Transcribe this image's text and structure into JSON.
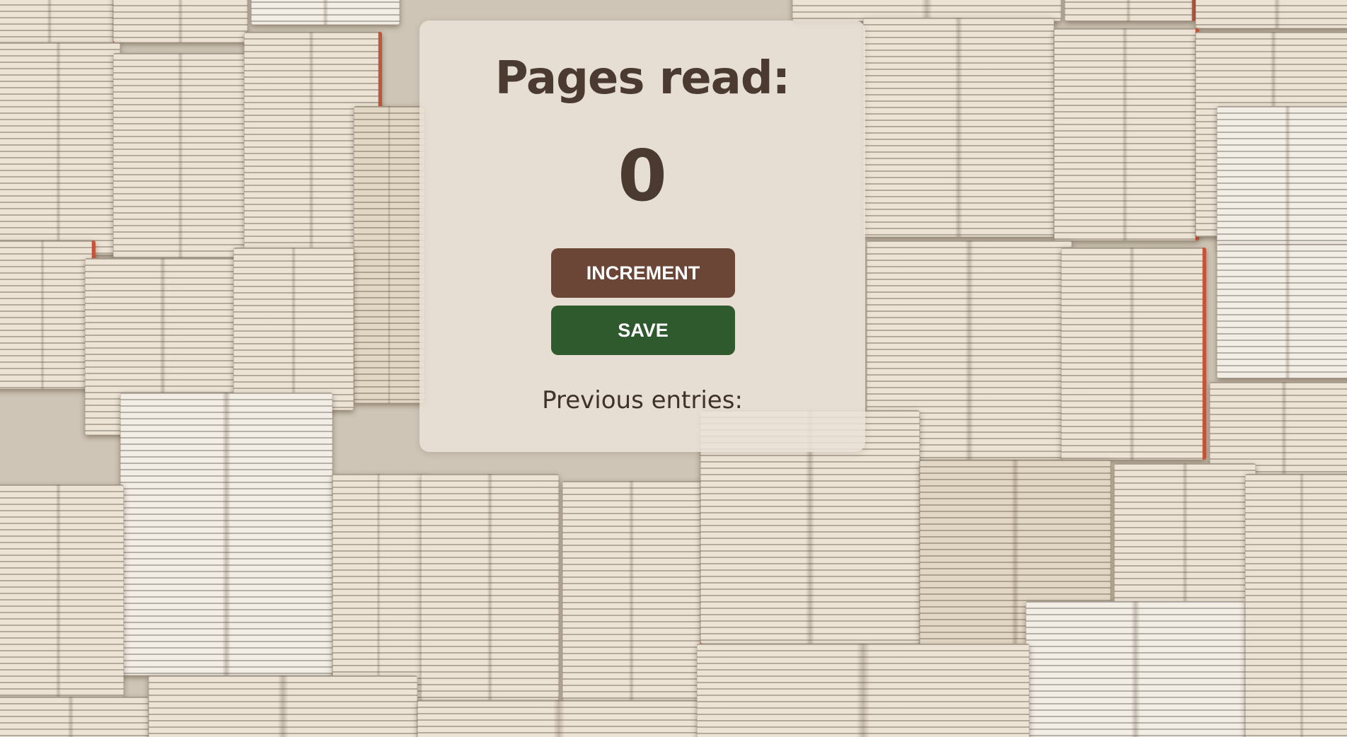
{
  "app": {
    "title": "Pages read:",
    "counter_value": "0"
  },
  "buttons": {
    "increment_label": "INCREMENT",
    "save_label": "SAVE"
  },
  "entries": {
    "heading": "Previous entries:",
    "items": []
  },
  "colors": {
    "text": "#4a3a30",
    "increment_button": "#6b4535",
    "save_button": "#2f5a2e",
    "card_background": "#eae2d7"
  }
}
